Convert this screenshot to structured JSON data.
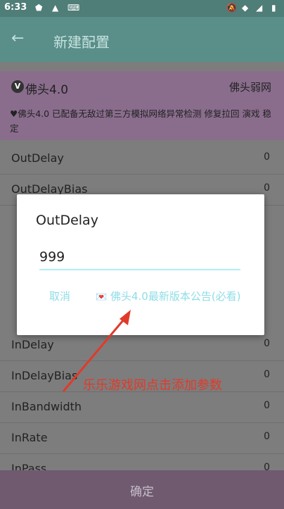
{
  "status": {
    "time": "6:33"
  },
  "appbar": {
    "title": "新建配置"
  },
  "profile": {
    "badge": "V",
    "name": "佛头4.0",
    "right_label": "佛头弱网"
  },
  "note": {
    "text": "♥佛头4.0 已配备无敌过第三方模拟网络异常检测 修复拉回 演戏 稳定"
  },
  "rows": [
    {
      "label": "OutDelay",
      "value": "0"
    },
    {
      "label": "OutDelayBias",
      "value": "0"
    },
    {
      "label": "InDelay",
      "value": "0"
    },
    {
      "label": "InDelayBias",
      "value": "0"
    },
    {
      "label": "InBandwidth",
      "value": "0"
    },
    {
      "label": "InRate",
      "value": "0"
    },
    {
      "label": "InPass",
      "value": "0"
    }
  ],
  "dialog": {
    "title": "OutDelay",
    "input_value": "999",
    "cancel_label": "取消",
    "notice_label": "佛头4.0最新版本公告(必看)"
  },
  "bottom": {
    "confirm_label": "确定"
  },
  "overlay": {
    "text": "乐乐游戏网点击添加参数"
  }
}
